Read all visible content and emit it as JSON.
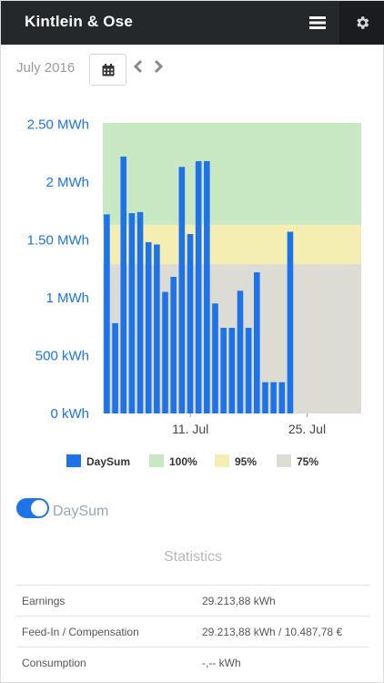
{
  "header": {
    "title": "Kintlein & Ose"
  },
  "controls": {
    "period": "July 2016"
  },
  "chart_data": {
    "type": "bar",
    "series": [
      {
        "name": "DaySum",
        "x": [
          "2016-07-01",
          "2016-07-02",
          "2016-07-03",
          "2016-07-04",
          "2016-07-05",
          "2016-07-06",
          "2016-07-07",
          "2016-07-08",
          "2016-07-09",
          "2016-07-10",
          "2016-07-11",
          "2016-07-12",
          "2016-07-13",
          "2016-07-14",
          "2016-07-15",
          "2016-07-16",
          "2016-07-17",
          "2016-07-18",
          "2016-07-19",
          "2016-07-20",
          "2016-07-21",
          "2016-07-22",
          "2016-07-23"
        ],
        "values": [
          1.72,
          0.78,
          2.22,
          1.73,
          1.74,
          1.48,
          1.46,
          1.05,
          1.18,
          2.13,
          1.55,
          2.18,
          2.18,
          0.95,
          0.74,
          0.74,
          1.06,
          0.74,
          1.22,
          0.27,
          0.27,
          0.27,
          1.57
        ]
      }
    ],
    "bands": [
      {
        "name": "100%",
        "from": 1.63,
        "to": 2.51,
        "color": "#c8e8c4"
      },
      {
        "name": "95%",
        "from": 1.29,
        "to": 1.63,
        "color": "#f5eeb2"
      },
      {
        "name": "75%",
        "from": 0,
        "to": 1.29,
        "color": "#dcdcd4"
      }
    ],
    "x_ticks": [
      "11. Jul",
      "25. Jul"
    ],
    "x_tick_dates": [
      "2016-07-11",
      "2016-07-25"
    ],
    "xlim": [
      "2016-07-01",
      "2016-07-31"
    ],
    "y_ticks": [
      "0 kWh",
      "500 kWh",
      "1 MWh",
      "1.50 MWh",
      "2 MWh",
      "2.50 MWh"
    ],
    "y_tick_values": [
      0,
      0.5,
      1,
      1.5,
      2,
      2.5
    ],
    "ylim": [
      0,
      2.51
    ],
    "legend": [
      "DaySum",
      "100%",
      "95%",
      "75%"
    ],
    "legend_position": "bottom",
    "colors": {
      "bar": "#1f73e8",
      "axis_text": "#1f73e8"
    }
  },
  "toggle": {
    "label": "DaySum",
    "on": true
  },
  "statistics": {
    "title": "Statistics",
    "rows": [
      {
        "label": "Earnings",
        "value": "29.213,88 kWh"
      },
      {
        "label": "Feed-In / Compensation",
        "value": "29.213,88 kWh / 10.487,78 €"
      },
      {
        "label": "Consumption",
        "value": "-,-- kWh"
      }
    ]
  },
  "icons": [
    "menu-icon",
    "gear-icon",
    "calendar-icon",
    "chevron-left-icon",
    "chevron-right-icon"
  ]
}
